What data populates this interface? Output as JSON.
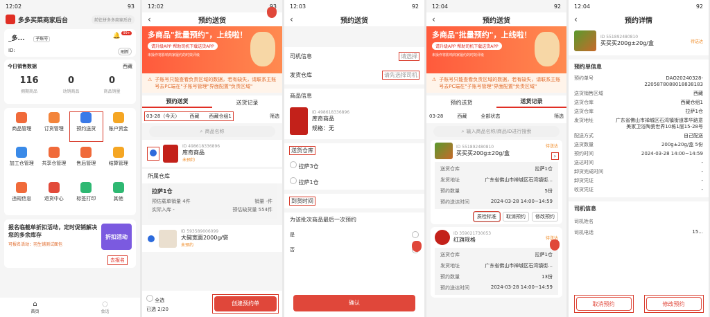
{
  "p1": {
    "time": "12:02",
    "battery": "93",
    "app": "多多买菜商家后台",
    "goto": "前往拼多多商家后台",
    "user": "_多...",
    "tag": "子账号",
    "id_label": "ID:",
    "refresh": "刷新",
    "badge": "99+",
    "sales_title": "今日销售数据",
    "region": "西藏",
    "stats": [
      {
        "v": "116",
        "l": "拥期商品"
      },
      {
        "v": "0",
        "l": "动销商品"
      },
      {
        "v": "0",
        "l": "商品销量"
      }
    ],
    "grid": [
      {
        "l": "商品管理",
        "c": "#f06a3a"
      },
      {
        "l": "订货管理",
        "c": "#f3843a"
      },
      {
        "l": "预约送货",
        "c": "#3a7ae8"
      },
      {
        "l": "账户资金",
        "c": "#f5a623"
      },
      {
        "l": "加工仓管理",
        "c": "#3a8ae8"
      },
      {
        "l": "共享仓管理",
        "c": "#f06a3a"
      },
      {
        "l": "售后管理",
        "c": "#f06a3a"
      },
      {
        "l": "结算管理",
        "c": "#f5a623"
      },
      {
        "l": "违规信息",
        "c": "#f06a3a"
      },
      {
        "l": "退货中心",
        "c": "#e24a3a"
      },
      {
        "l": "标签打印",
        "c": "#2eb872"
      },
      {
        "l": "其他",
        "c": "#2eb872"
      }
    ],
    "promo_title": "报名临截单折扣活动，定时促销解决您的多余库存",
    "promo_sub": "可报名活动：羽生铺测试面包",
    "promo_btn": "去报名",
    "promo_img": "折扣活动",
    "nav_home": "首页",
    "nav_msg": "会话"
  },
  "p2": {
    "time": "12:02",
    "title": "预约送货",
    "banner_t": "多商品\"批量预约\"，上线啦！",
    "banner_s": "请升级APP 帮助司机下载送货APP",
    "banner_n": "未操作将影响商家履约的时效评级",
    "notice": "子账号只能查看负责区域的数据，若有缺失，请联系主账号去PC端在\"子账号管理\"界面配置\"负责区域\"",
    "tabs": [
      "预约送货",
      "送货记录"
    ],
    "filters": [
      "03-28（今天）",
      "西藏",
      "西藏仓组1"
    ],
    "filter_btn": "筛选",
    "search": "商品名称",
    "p_id": "ID 498618336896",
    "p_name": "库奇商品",
    "p_tag": "未预约",
    "wh_title": "所属仓库",
    "wh": "拉萨1仓",
    "wh_r1a": "预估载单销量 4件",
    "wh_r1b": "销量 -件",
    "wh_r2a": "实际入库 -",
    "wh_r2b": "预估缺货量 554件",
    "p2_id": "ID 593589006099",
    "p2_name": "大碗宽面2000g/袋",
    "p2_tag": "未预约",
    "all": "全选",
    "selected": "已选 2/20",
    "create": "创建预约单"
  },
  "p3": {
    "time": "12:03",
    "title": "预约送货",
    "driver": "司机信息",
    "driver_ph": "请选择",
    "wh": "发货仓库",
    "wh_ph": "请先选择司机",
    "goods": "商品信息",
    "g_id": "ID 498618336896",
    "g_name": "库奇商品",
    "g_spec": "规格：无",
    "ship_wh": "送货仓库",
    "opts": [
      "拉萨3仓",
      "拉萨1仓"
    ],
    "arrive": "到货时间",
    "last": "为该批次商品最后一次预约",
    "yes": "是",
    "no": "否",
    "confirm": "确认"
  },
  "p4": {
    "time": "12:04",
    "title": "预约送货",
    "tabs": [
      "预约送货",
      "送货记录"
    ],
    "filters": [
      "03-28",
      "西藏",
      "全部状态"
    ],
    "filter_btn": "筛选",
    "search": "输入商品名称/商品ID进行搜索",
    "o_id": "ID 551892480810",
    "o_status": "待送达",
    "o_name": "买买买200g±20g/盒",
    "rows": [
      [
        "送货仓库",
        "拉萨1仓"
      ],
      [
        "发货地址",
        "广东省佛山市禅城区石湾镇街..."
      ],
      [
        "预约数量",
        "5份"
      ],
      [
        "预约送达时间",
        "2024-03-28 14:00~14:59"
      ]
    ],
    "btns": [
      "质检标准",
      "取消预约",
      "修改预约"
    ],
    "o2_id": "ID 359021730053",
    "o2_status": "待送达",
    "o2_name": "红旗规格",
    "rows2": [
      [
        "送货仓库",
        "拉萨1仓"
      ],
      [
        "发货地址",
        "广东省佛山市禅城区石湾镇街..."
      ],
      [
        "预约数量",
        "13份"
      ],
      [
        "预约送达时间",
        "2024-03-28 14:00~14:59"
      ]
    ]
  },
  "p5": {
    "time": "12:04",
    "title": "预约详情",
    "id": "ID 551892480810",
    "status": "待送达",
    "name": "买买买200g±20g/盒",
    "sec1": "预约单信息",
    "rows": [
      [
        "预约单号",
        "DAO20240328-2205878088018838183"
      ],
      [
        "送货销售区域",
        "西藏"
      ],
      [
        "送货仓库",
        "西藏仓组1"
      ],
      [
        "送货仓库",
        "拉萨1仓"
      ],
      [
        "发货地址",
        "广东省佛山市禅城区石湾镇街道季华路意美家卫浴陶瓷世界10栋1层15-28号"
      ],
      [
        "配送方式",
        "自己配送"
      ],
      [
        "送货数量",
        "200g±20g/盒 5份"
      ],
      [
        "预约时间",
        "2024-03-28 14:00~14:59"
      ],
      [
        "送达时间",
        "-"
      ],
      [
        "卸货完成时间",
        "-"
      ],
      [
        "卸货凭证",
        "-"
      ],
      [
        "收货凭证",
        "-"
      ]
    ],
    "sec2": "司机信息",
    "drows": [
      [
        "司机姓名",
        ""
      ],
      [
        "司机电话",
        "15..."
      ]
    ],
    "cancel": "取消预约",
    "modify": "修改预约"
  }
}
